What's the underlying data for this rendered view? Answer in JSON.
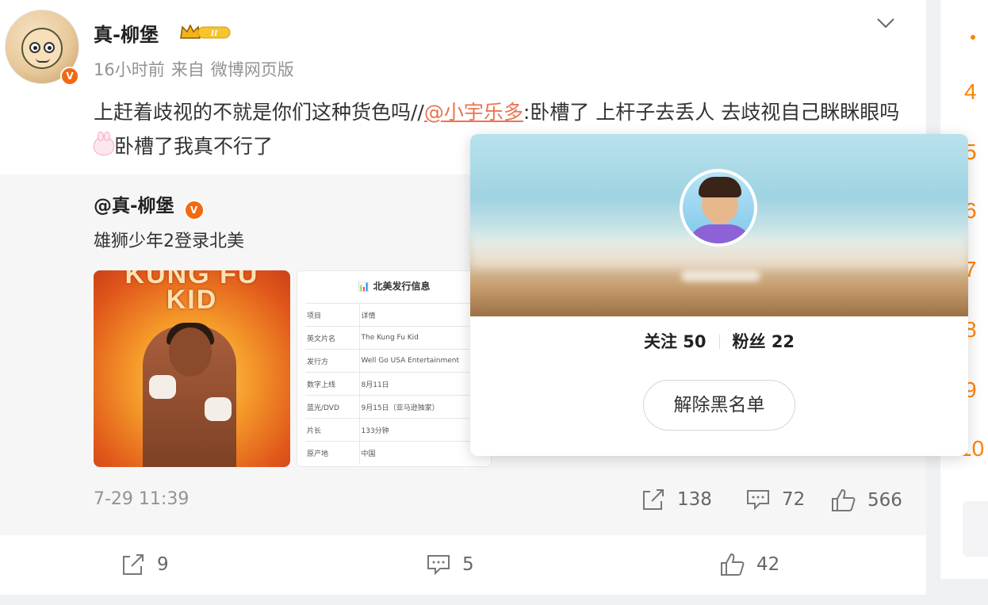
{
  "post": {
    "username": "真-柳堡",
    "time": "16小时前",
    "source_prefix": "来自",
    "source": "微博网页版",
    "text_before": "上赶着歧视的不就是你们这种货色吗//",
    "mention": "@小宇乐多",
    "text_after": ":卧槽了 上杆子去丢人 去歧视自己眯眯眼吗",
    "text_end": "卧槽了我真不行了",
    "crown_level": "II"
  },
  "repost": {
    "username": "@真-柳堡",
    "text": "雄狮少年2登录北美",
    "time": "7-29 11:39",
    "share_count": "138",
    "comment_count": "72",
    "like_count": "566",
    "poster_title_1": "KUNG FU",
    "poster_title_2": "KID",
    "table_title": "📊 北美发行信息",
    "table": [
      [
        "项目",
        "详情"
      ],
      [
        "英文片名",
        "The Kung Fu Kid"
      ],
      [
        "发行方",
        "Well Go USA Entertainment"
      ],
      [
        "数字上线",
        "8月11日"
      ],
      [
        "蓝光/DVD",
        "9月15日（亚马逊独家）"
      ],
      [
        "片长",
        "133分钟"
      ],
      [
        "原产地",
        "中国"
      ]
    ]
  },
  "actions": {
    "share": "9",
    "comment": "5",
    "like": "42"
  },
  "popup": {
    "following_label": "关注",
    "following": "50",
    "followers_label": "粉丝",
    "followers": "22",
    "unblock_label": "解除黑名单"
  },
  "sidebar": {
    "ranks": [
      "4",
      "5",
      "6",
      "7",
      "8",
      "9",
      "10"
    ]
  },
  "colors": {
    "accent": "#eb7350",
    "rank": "#ff8200",
    "badge": "#f26a10"
  }
}
